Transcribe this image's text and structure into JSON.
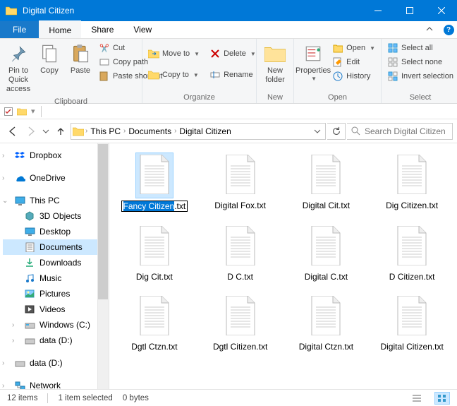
{
  "window": {
    "title": "Digital Citizen"
  },
  "menu": {
    "file": "File",
    "home": "Home",
    "share": "Share",
    "view": "View"
  },
  "ribbon": {
    "clipboard": {
      "label": "Clipboard",
      "pin": "Pin to Quick access",
      "copy": "Copy",
      "paste": "Paste",
      "cut": "Cut",
      "copypath": "Copy path",
      "pasteshortcut": "Paste shortcut"
    },
    "organize": {
      "label": "Organize",
      "moveto": "Move to",
      "copyto": "Copy to",
      "delete": "Delete",
      "rename": "Rename"
    },
    "new": {
      "label": "New",
      "newfolder": "New folder"
    },
    "open": {
      "label": "Open",
      "properties": "Properties",
      "open": "Open",
      "edit": "Edit",
      "history": "History"
    },
    "select": {
      "label": "Select",
      "all": "Select all",
      "none": "Select none",
      "invert": "Invert selection"
    }
  },
  "breadcrumb": {
    "root": "This PC",
    "p1": "Documents",
    "p2": "Digital Citizen"
  },
  "search": {
    "placeholder": "Search Digital Citizen"
  },
  "sidebar": {
    "dropbox": "Dropbox",
    "onedrive": "OneDrive",
    "thispc": "This PC",
    "objects3d": "3D Objects",
    "desktop": "Desktop",
    "documents": "Documents",
    "downloads": "Downloads",
    "music": "Music",
    "pictures": "Pictures",
    "videos": "Videos",
    "windowsc": "Windows (C:)",
    "datad1": "data (D:)",
    "datad2": "data (D:)",
    "network": "Network"
  },
  "files": [
    {
      "name": "Fancy Citizen",
      "ext": ".txt",
      "renaming": true
    },
    {
      "name": "Digital Fox.txt"
    },
    {
      "name": "Digital Cit.txt"
    },
    {
      "name": "Dig Citizen.txt"
    },
    {
      "name": "Dig Cit.txt"
    },
    {
      "name": "D C.txt"
    },
    {
      "name": "Digital C.txt"
    },
    {
      "name": "D Citizen.txt"
    },
    {
      "name": "Dgtl Ctzn.txt"
    },
    {
      "name": "Dgtl Citizen.txt"
    },
    {
      "name": "Digital Ctzn.txt"
    },
    {
      "name": "Digital Citizen.txt"
    }
  ],
  "status": {
    "count": "12 items",
    "selected": "1 item selected",
    "size": "0 bytes"
  }
}
